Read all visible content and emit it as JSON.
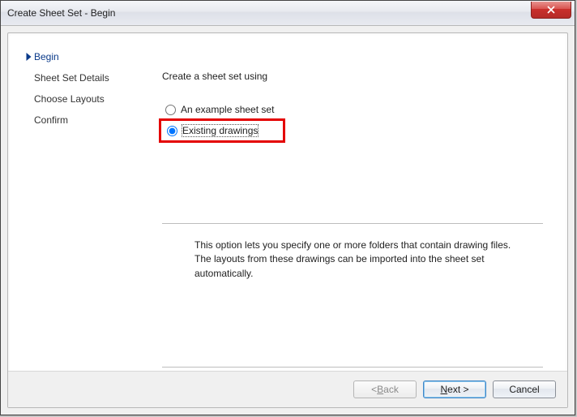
{
  "window": {
    "title": "Create Sheet Set - Begin"
  },
  "nav": {
    "items": [
      {
        "label": "Begin",
        "current": true
      },
      {
        "label": "Sheet Set Details",
        "current": false
      },
      {
        "label": "Choose Layouts",
        "current": false
      },
      {
        "label": "Confirm",
        "current": false
      }
    ]
  },
  "main": {
    "prompt": "Create a sheet set using",
    "options": [
      {
        "label": "An example sheet set",
        "selected": false
      },
      {
        "label": "Existing drawings",
        "selected": true,
        "highlighted": true
      }
    ],
    "description": "This option lets you specify one or more folders that contain drawing files.  The layouts from these drawings can be imported into the sheet set automatically."
  },
  "buttons": {
    "back": {
      "text": "< ",
      "key": "B",
      "rest": "ack",
      "enabled": false
    },
    "next": {
      "key": "N",
      "rest": "ext >",
      "enabled": true,
      "default": true
    },
    "cancel": {
      "text": "Cancel",
      "enabled": true
    }
  }
}
